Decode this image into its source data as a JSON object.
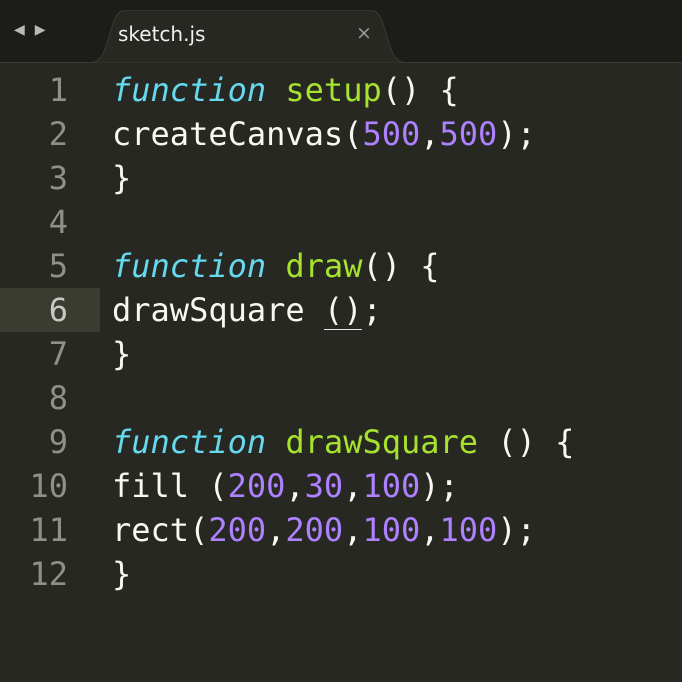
{
  "nav": {
    "back_label": "◀",
    "forward_label": "▶"
  },
  "tab": {
    "title": "sketch.js",
    "close_label": "×"
  },
  "editor": {
    "current_line": 6,
    "lines": [
      {
        "number": "1",
        "tokens": [
          {
            "t": "function",
            "c": "kw"
          },
          {
            "t": " ",
            "c": ""
          },
          {
            "t": "setup",
            "c": "fn"
          },
          {
            "t": "() {",
            "c": ""
          }
        ]
      },
      {
        "number": "2",
        "tokens": [
          {
            "t": "createCanvas(",
            "c": ""
          },
          {
            "t": "500",
            "c": "num"
          },
          {
            "t": ",",
            "c": ""
          },
          {
            "t": "500",
            "c": "num"
          },
          {
            "t": ");",
            "c": ""
          }
        ]
      },
      {
        "number": "3",
        "tokens": [
          {
            "t": "}",
            "c": ""
          }
        ]
      },
      {
        "number": "4",
        "tokens": []
      },
      {
        "number": "5",
        "tokens": [
          {
            "t": "function",
            "c": "kw"
          },
          {
            "t": " ",
            "c": ""
          },
          {
            "t": "draw",
            "c": "fn"
          },
          {
            "t": "() {",
            "c": ""
          }
        ]
      },
      {
        "number": "6",
        "tokens": [
          {
            "t": "drawSquare ",
            "c": ""
          },
          {
            "t": "()",
            "c": "bracket-match"
          },
          {
            "t": ";",
            "c": ""
          }
        ]
      },
      {
        "number": "7",
        "tokens": [
          {
            "t": "}",
            "c": ""
          }
        ]
      },
      {
        "number": "8",
        "tokens": []
      },
      {
        "number": "9",
        "tokens": [
          {
            "t": "function",
            "c": "kw"
          },
          {
            "t": " ",
            "c": ""
          },
          {
            "t": "drawSquare",
            "c": "fn"
          },
          {
            "t": " () {",
            "c": ""
          }
        ]
      },
      {
        "number": "10",
        "tokens": [
          {
            "t": "fill (",
            "c": ""
          },
          {
            "t": "200",
            "c": "num"
          },
          {
            "t": ",",
            "c": ""
          },
          {
            "t": "30",
            "c": "num"
          },
          {
            "t": ",",
            "c": ""
          },
          {
            "t": "100",
            "c": "num"
          },
          {
            "t": ");",
            "c": ""
          }
        ]
      },
      {
        "number": "11",
        "tokens": [
          {
            "t": "rect(",
            "c": ""
          },
          {
            "t": "200",
            "c": "num"
          },
          {
            "t": ",",
            "c": ""
          },
          {
            "t": "200",
            "c": "num"
          },
          {
            "t": ",",
            "c": ""
          },
          {
            "t": "100",
            "c": "num"
          },
          {
            "t": ",",
            "c": ""
          },
          {
            "t": "100",
            "c": "num"
          },
          {
            "t": ");",
            "c": ""
          }
        ]
      },
      {
        "number": "12",
        "tokens": [
          {
            "t": "}",
            "c": ""
          }
        ]
      }
    ]
  },
  "colors": {
    "background": "#272822",
    "tabbar": "#1c1d18",
    "keyword": "#66d9ef",
    "function_name": "#a6e22e",
    "number": "#ae81ff",
    "text": "#f8f8f2",
    "gutter": "#8f908a"
  }
}
